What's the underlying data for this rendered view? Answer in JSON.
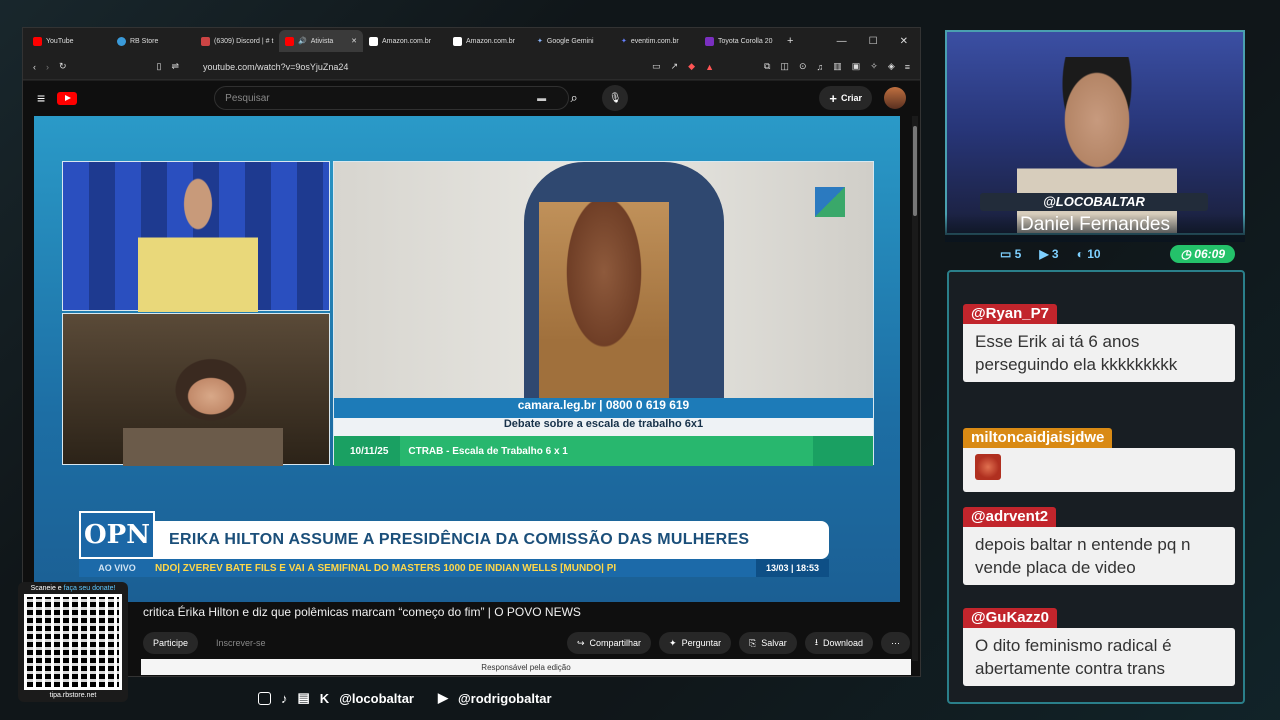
{
  "browser": {
    "tabs": [
      {
        "label": "YouTube",
        "color": "#ff0000"
      },
      {
        "label": "RB Store",
        "color": "#3a9ad9"
      },
      {
        "label": "(6309) Discord | # t",
        "color": "#5865f2"
      },
      {
        "label": "Ativista",
        "color": "#ff0000",
        "active": true
      },
      {
        "label": "Amazon.com.br",
        "color": "#ffffff"
      },
      {
        "label": "Amazon.com.br",
        "color": "#ffffff"
      },
      {
        "label": "Google Gemini",
        "color": "#8ab4f8"
      },
      {
        "label": "eventim.com.br",
        "color": "#3355cc"
      },
      {
        "label": "Toyota Corolla 20",
        "color": "#7a2fc0"
      }
    ],
    "url": "youtube.com/watch?v=9osYjuZna24"
  },
  "youtube": {
    "search_placeholder": "Pesquisar",
    "create_label": "Criar",
    "video_title": "critica Érika Hilton e diz que polêmicas marcam “começo do fim” | O POVO NEWS",
    "join_label": "Participe",
    "subscribe_label": "Inscrever-se",
    "share_label": "Compartilhar",
    "ask_label": "Perguntar",
    "save_label": "Salvar",
    "download_label": "Download",
    "responsible_label": "Responsável pela edição"
  },
  "broadcast": {
    "camara_bar": "camara.leg.br | 0800 0 619 619",
    "debate_bar": "Debate sobre a escala de trabalho 6x1",
    "date": "10/11/25",
    "ctrab": "CTRAB - Escala de Trabalho 6 x 1",
    "channel_logo": "OPN",
    "live_label": "AO VIVO",
    "headline": "ERIKA HILTON ASSUME A PRESIDÊNCIA DA COMISSÃO DAS MULHERES",
    "ticker": "NDO| ZVEREV BATE FILS E VAI À SEMIFINAL DO MASTERS 1000 DE INDIAN WELLS   [MUNDO| PI",
    "ticker_time": "13/03 | 18:53"
  },
  "stream": {
    "handle": "@LOCOBALTAR",
    "streamer_name": "Daniel Fernandes",
    "stat_chat": "5",
    "stat_viewers": "3",
    "stat_subs": "10",
    "timer": "06:09"
  },
  "chat": {
    "messages": [
      {
        "user": "@Ryan_P7",
        "text": "Esse Erik ai tá 6 anos perseguindo ela kkkkkkkkk",
        "color": "#c2252c"
      },
      {
        "user": "miltoncaidjaisjdwe",
        "text": "",
        "color": "#d98a14"
      },
      {
        "user": "@adrvent2",
        "text": "depois baltar n entende pq n vende placa de video",
        "color": "#c2252c"
      },
      {
        "user": "@GuKazz0",
        "text": "O dito feminismo radical é abertamente contra trans",
        "color": "#c2252c"
      }
    ]
  },
  "overlay": {
    "qr_title_a": "Scaneie e",
    "qr_title_b": "faça seu donate!",
    "qr_site": "tipa.rbstore.net",
    "social_a": "@locobaltar",
    "social_b": "@rodrigobaltar"
  }
}
